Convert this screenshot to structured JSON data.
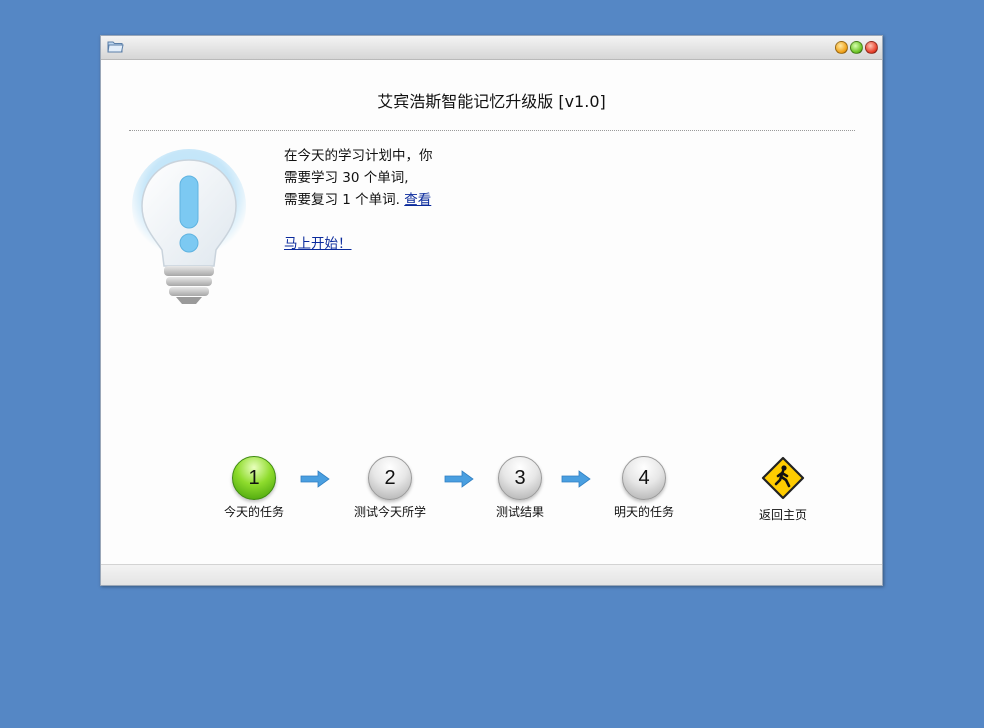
{
  "window": {
    "folder_icon": "folder-icon",
    "controls": [
      "minimize-button",
      "maximize-button",
      "close-button"
    ]
  },
  "app_title": "艾宾浩斯智能记忆升级版 [v1.0]",
  "info": {
    "line1": "在今天的学习计划中，你",
    "line2": "需要学习 30 个单词,",
    "line3_text": "需要复习 1 个单词.",
    "view_link": "查看",
    "start_link": "马上开始！"
  },
  "steps": [
    {
      "number": "1",
      "label": "今天的任务",
      "state": "active"
    },
    {
      "number": "2",
      "label": "测试今天所学",
      "state": "inactive"
    },
    {
      "number": "3",
      "label": "测试结果",
      "state": "inactive"
    },
    {
      "number": "4",
      "label": "明天的任务",
      "state": "inactive"
    }
  ],
  "home": {
    "label": "返回主页",
    "icon": "pedestrian-sign-icon"
  },
  "colors": {
    "desktop": "#5587c5",
    "link": "#0a2a9c",
    "active_step": "#6cc425",
    "arrow": "#4a9fe0"
  }
}
